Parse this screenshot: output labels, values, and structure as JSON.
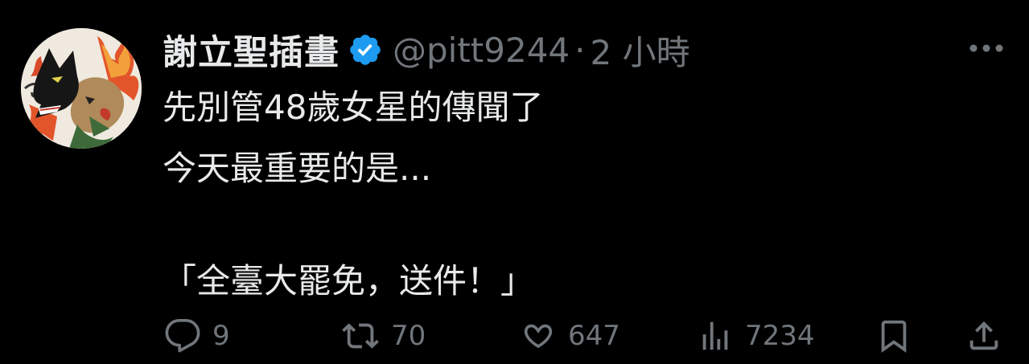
{
  "user": {
    "display_name": "謝立聖插畫",
    "handle": "@pitt9244",
    "separator": "·",
    "time": "2 小時",
    "verified_color": "#1d9bf0"
  },
  "tweet": {
    "lines": [
      "先別管48歲女星的傳聞了",
      "今天最重要的是...",
      "",
      "「全臺大罷免，送件！」"
    ]
  },
  "actions": {
    "reply": {
      "icon": "reply-icon",
      "count": "9"
    },
    "retweet": {
      "icon": "retweet-icon",
      "count": "70"
    },
    "like": {
      "icon": "heart-icon",
      "count": "647"
    },
    "views": {
      "icon": "views-icon",
      "count": "7234"
    },
    "bookmark": {
      "icon": "bookmark-icon"
    },
    "share": {
      "icon": "share-icon"
    }
  },
  "colors": {
    "background": "#000000",
    "text": "#e7e9ea",
    "muted": "#71767b"
  }
}
